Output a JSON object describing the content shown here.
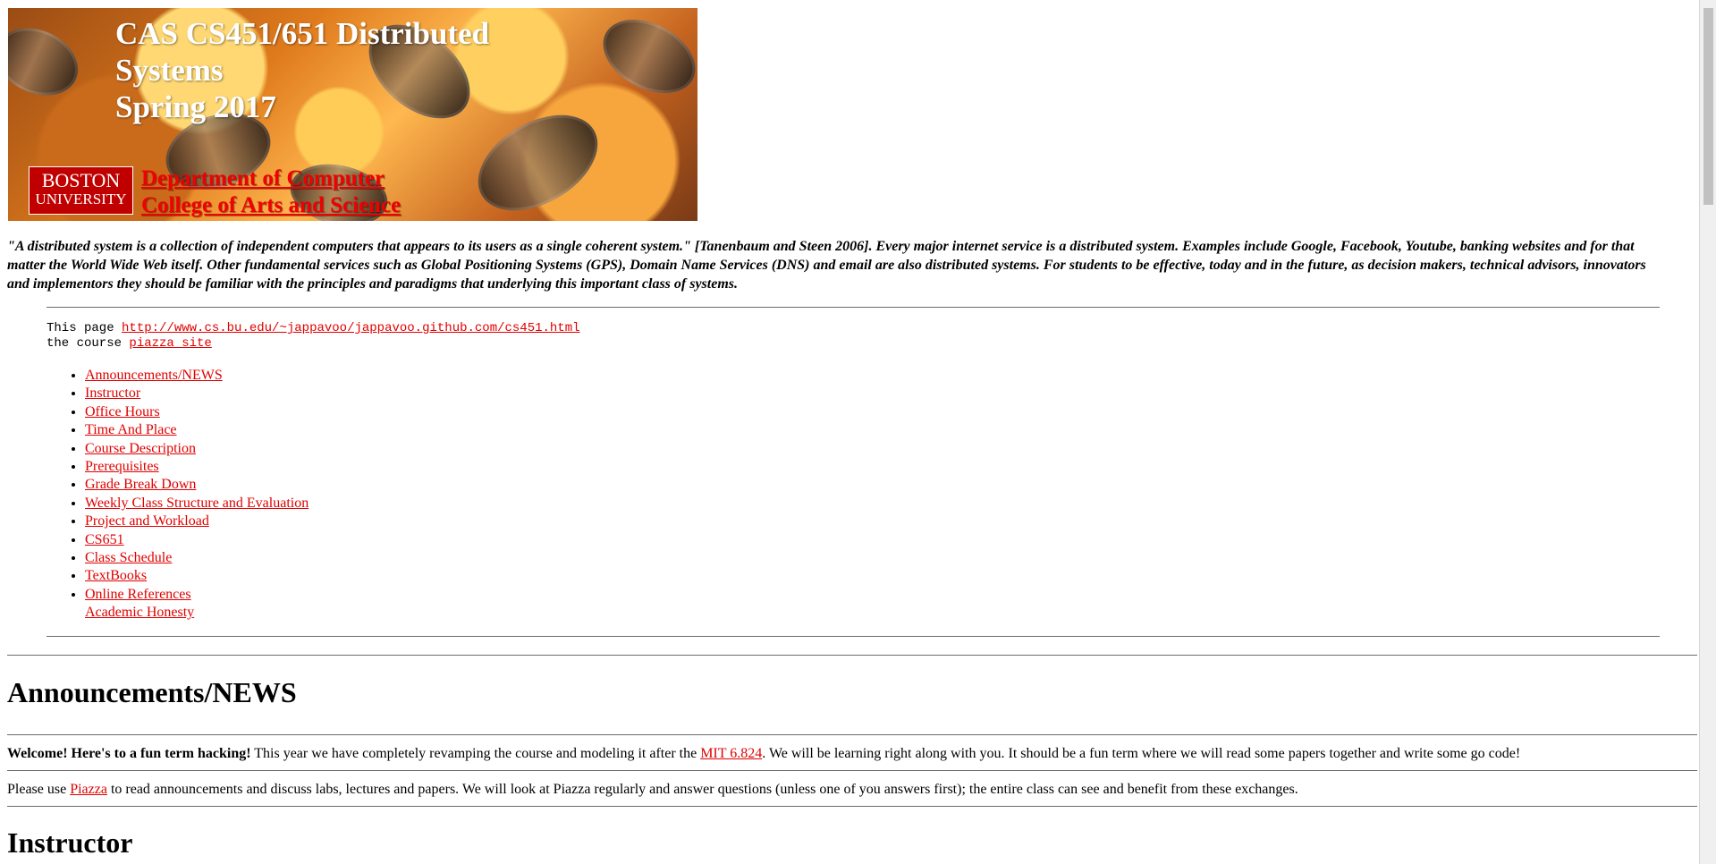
{
  "banner": {
    "title_lines": [
      "CAS CS451/651 Distributed",
      "Systems",
      "Spring 2017"
    ],
    "logo_line1": "BOSTON",
    "logo_line2": "UNIVERSITY",
    "dept_line1": "Department of Computer",
    "dept_line2": "College of Arts and Science"
  },
  "intro": {
    "quote": "\"A distributed system is a collection of independent computers that appears to its users as a single coherent system.\" [Tanenbaum and Steen 2006]. Every major internet service is a distributed system. Examples include Google, Facebook, Youtube, banking websites and for that matter the World Wide Web itself. Other fundamental services such as Global Positioning Systems (GPS), Domain Name Services (DNS) and email are also distributed systems. For students to be effective, today and in the future, as decision makers, technical advisors, innovators and implementors they should be familiar with the principles and paradigms that underlying this important class of systems."
  },
  "links": {
    "this_page_label": "This page",
    "this_page_url": "http://www.cs.bu.edu/~jappavoo/jappavoo.github.com/cs451.html",
    "course_label": "the course",
    "piazza_site": "piazza site"
  },
  "toc": [
    "Announcements/NEWS",
    "Instructor",
    "Office Hours",
    "Time And Place",
    "Course Description",
    "Prerequisites",
    "Grade Break Down",
    "Weekly Class Structure and Evaluation",
    "Project and Workload",
    "CS651",
    "Class Schedule",
    "TextBooks",
    "Online References",
    "Academic Honesty"
  ],
  "announcements": {
    "heading": "Announcements/NEWS",
    "welcome_bold": "Welcome! Here's to a fun term hacking!",
    "welcome_text_1": " This year we have completely revamping the course and modeling it after the ",
    "mit_link": "MIT 6.824",
    "welcome_text_2": ". We will be learning right along with you. It should be a fun term where we will read some papers together and write some go code!",
    "piazza_pre": "Please use ",
    "piazza_link": "Piazza",
    "piazza_post": " to read announcements and discuss labs, lectures and papers. We will look at Piazza regularly and answer questions (unless one of you answers first); the entire class can see and benefit from these exchanges."
  },
  "instructor": {
    "heading": "Instructor"
  },
  "colors": {
    "link": "#e00000",
    "logo_red": "#c00000"
  }
}
